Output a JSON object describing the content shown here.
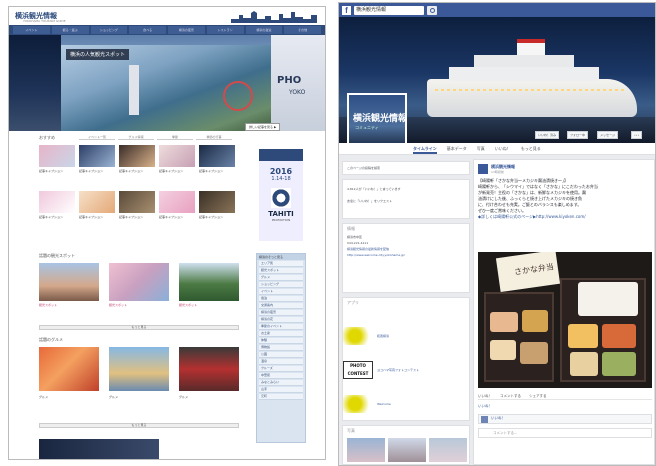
{
  "left": {
    "logo": "横浜観光情報",
    "logo_sub": "YOKOHAMA TOURISM GUIDE",
    "nav": [
      "イベント",
      "観る・遊ぶ",
      "ショッピング",
      "食べる",
      "横浜の夜景",
      "レストラン",
      "横浜の宿泊",
      "その他"
    ],
    "hero_caption": "横浜の人気観光スポット",
    "hero_pho": "PHO",
    "hero_pho_sub": "YOKO",
    "hero_more": "詳しい記事を見る ▶",
    "section1": "おすすめ",
    "tabs": [
      "イベント一覧",
      "グルメ情報",
      "季節",
      "季節の行事"
    ],
    "thumb_caps": [
      "記事キャプション",
      "記事キャプション",
      "記事キャプション",
      "記事キャプション",
      "記事キャプション",
      "記事キャプション",
      "記事キャプション",
      "記事キャプション",
      "記事キャプション",
      "記事キャプション"
    ],
    "ad_year": "2016",
    "ad_date": "1.14-18",
    "ad_brand": "TAHITI",
    "ad_brand_sub": "PROMOTION",
    "section2": "話題の観光スポット",
    "big_caps": [
      "観光スポット",
      "観光スポット",
      "観光スポット"
    ],
    "more1": "もっと見る",
    "section3": "話題のグルメ",
    "big_caps2": [
      "グルメ",
      "グルメ",
      "グルメ"
    ],
    "more2": "もっと見る",
    "side_head": "横浜のそっと見る",
    "side_items": [
      "エリア別",
      "観光スポット",
      "グルメ",
      "ショッピング",
      "イベント",
      "宿泊",
      "交通案内",
      "横浜の夜景",
      "横浜の花",
      "季節のイベント",
      "お土産",
      "体験",
      "博物館",
      "公園",
      "温泉",
      "クルーズ",
      "中華街",
      "みなとみらい",
      "山手",
      "元町"
    ]
  },
  "right": {
    "search_value": "横浜観光情報",
    "page_title": "横浜観光情報",
    "page_sub": "コミュニティ",
    "cover_buttons": [
      "いいね！済み",
      "フォロー中",
      "メッセージ",
      "•••"
    ],
    "tabs": [
      "タイムライン",
      "基本データ",
      "写真",
      "いいね！",
      "もっと見る"
    ],
    "left_search": "このページの投稿を検索",
    "left_rows": [
      "4,812人が「いいね！」と言っています",
      "友達に「いいね！」をリクエスト"
    ],
    "info_head": "情報",
    "info_rows": [
      "横浜市中区",
      "044-221-4111",
      "横浜観光情報の最新情報を配信",
      "http://www.welcome.city.yokohama.jp/"
    ],
    "apps_head": "アプリ",
    "apps": [
      "和風横浜",
      "ヨコハマ写真フォトコンテスト",
      "Welcome"
    ],
    "apps_labels": [
      "和風横浜",
      "PHOTO CONTEST",
      "Welcome"
    ],
    "photos_head": "写真",
    "post_name": "横浜観光情報",
    "post_time": "13時間前",
    "post_lines": [
      "【崎陽軒「さかな弁当～メカジキ醤油漬焼き～」】",
      "崎陽軒から、「シウマイ」ではなく「さかな」にこだわったお弁当",
      "が新発売！主役の「さかな」は、新鮮なメカジキを使用。醤",
      "油漬けにした後、ふっくらと焼き上げたメカジキの焼き魚",
      "に、付け合わせも充実。ご飯とのバランスも楽しめます。",
      "ぜひ一度ご賞味ください。",
      "◆詳しくは崎陽軒公式のページ▶http://www.kiyoken.com/"
    ],
    "bento_lid": "さかな弁当",
    "post_actions": [
      "いいね！",
      "コメントする",
      "シェアする"
    ],
    "likes_line": "いいね！",
    "comment_name": "いいね！",
    "comment_placeholder": "コメントする..."
  }
}
